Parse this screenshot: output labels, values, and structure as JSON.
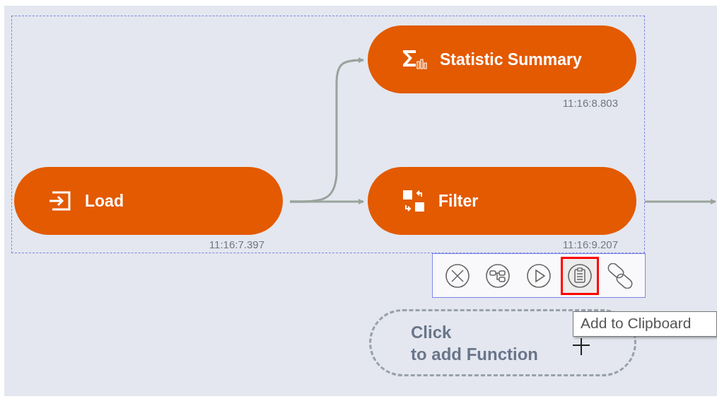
{
  "nodes": [
    {
      "kind": "statistic",
      "label": "Statistic Summary",
      "time": "11:16:8.803"
    },
    {
      "kind": "load",
      "label": "Load",
      "time": "11:16:7.397"
    },
    {
      "kind": "filter",
      "label": "Filter",
      "time": "11:16:9.207"
    }
  ],
  "toolbar": [
    {
      "kind": "delete",
      "selected": false
    },
    {
      "kind": "flow",
      "selected": false
    },
    {
      "kind": "run",
      "selected": false
    },
    {
      "kind": "clipboard",
      "selected": true
    },
    {
      "kind": "link",
      "selected": false
    }
  ],
  "tooltip": "Add to Clipboard",
  "add_function": {
    "lines": [
      "Click",
      "to add Function"
    ]
  }
}
